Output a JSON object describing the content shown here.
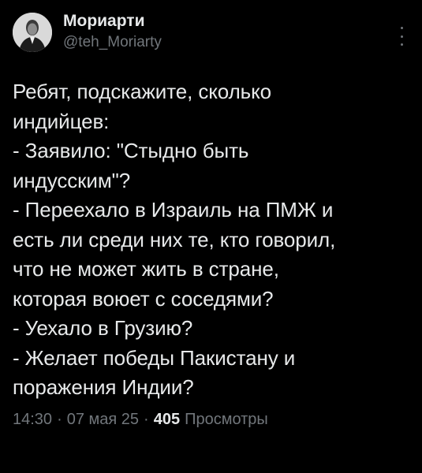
{
  "author": {
    "display_name": "Мориарти",
    "handle": "@teh_Moriarty",
    "avatar_icon": "avatar-portrait-icon",
    "more_icon": "more-options-icon"
  },
  "tweet": {
    "text": "Ребят, подскажите, сколько\nиндийцев:\n- Заявило: \"Стыдно быть\nиндусским\"?\n- Переехало в Израиль на ПМЖ и\nесть ли среди них те, кто говорил,\nчто не может жить в стране,\nкоторая воюет с соседями?\n- Уехало в Грузию?\n- Желает победы Пакистану и\nпоражения Индии?"
  },
  "meta": {
    "time": "14:30",
    "separator1": "·",
    "date": "07 мая 25",
    "separator2": "·",
    "views_count": "405",
    "views_label": "Просмотры"
  },
  "colors": {
    "background": "#000000",
    "primary_text": "#e7e9ea",
    "secondary_text": "#71767b"
  }
}
